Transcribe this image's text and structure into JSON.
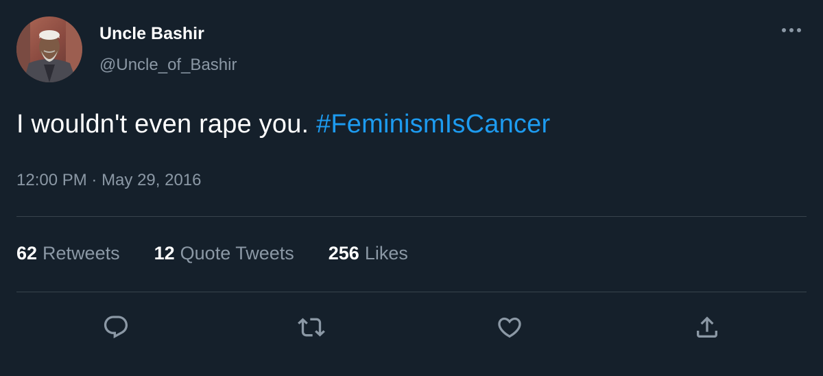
{
  "author": {
    "display_name": "Uncle Bashir",
    "handle": "@Uncle_of_Bashir"
  },
  "tweet": {
    "text": "I wouldn't even rape you. ",
    "hashtag": "#FeminismIsCancer",
    "time": "12:00 PM",
    "separator": " · ",
    "date": "May 29, 2016"
  },
  "stats": {
    "retweets_count": "62",
    "retweets_label": "Retweets",
    "quotes_count": "12",
    "quotes_label": "Quote Tweets",
    "likes_count": "256",
    "likes_label": "Likes"
  },
  "icons": {
    "more": "more-horizontal-icon",
    "reply": "reply-icon",
    "retweet": "retweet-icon",
    "like": "heart-icon",
    "share": "share-icon"
  },
  "colors": {
    "background": "#15202b",
    "text": "#ffffff",
    "secondary": "#8b98a5",
    "accent": "#1d9bf0",
    "divider": "#38444d"
  }
}
